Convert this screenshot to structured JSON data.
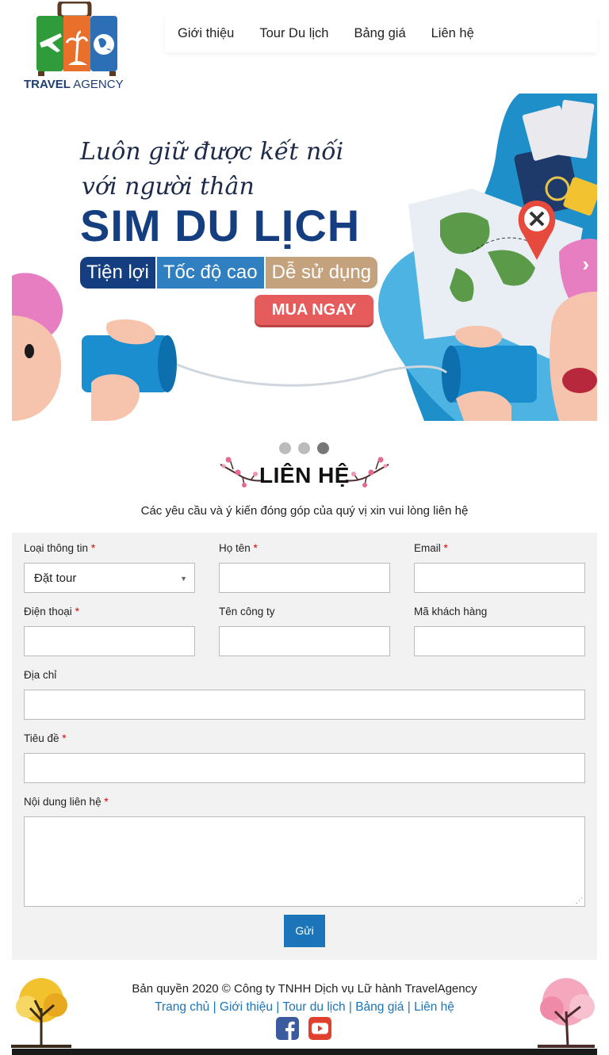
{
  "brand": {
    "logo_text_bold": "TRAVEL",
    "logo_text_light": " AGENCY"
  },
  "nav": {
    "items": [
      "Giới thiệu",
      "Tour Du lịch",
      "Bảng giá",
      "Liên hệ"
    ]
  },
  "banner": {
    "line1": "Luôn giữ được kết nối",
    "line2": "với người thân",
    "headline": "SIM DU LỊCH",
    "pills": [
      "Tiện lợi",
      "Tốc độ cao",
      "Dễ sử dụng"
    ],
    "button": "MUA NGAY",
    "next": "›"
  },
  "carousel": {
    "slide_count": 3,
    "active_index": 2
  },
  "contact": {
    "title": "LIÊN HỆ",
    "subtitle": "Các yêu cầu và ý kiến đóng góp của quý vị xin vui lòng liên hệ"
  },
  "form": {
    "req_mark": "*",
    "info_type": {
      "label": "Loại thông tin",
      "value": "Đặt tour"
    },
    "full_name": {
      "label": "Họ tên",
      "value": ""
    },
    "email": {
      "label": "Email",
      "value": ""
    },
    "phone": {
      "label": "Điện thoại",
      "value": ""
    },
    "company": {
      "label": "Tên công ty",
      "value": ""
    },
    "customer_code": {
      "label": "Mã khách hàng",
      "value": ""
    },
    "address": {
      "label": "Địa chỉ",
      "value": ""
    },
    "subject": {
      "label": "Tiêu đề",
      "value": ""
    },
    "message": {
      "label": "Nội dung liên hệ",
      "value": ""
    },
    "submit": "Gửi"
  },
  "footer": {
    "copyright": "Bản quyền 2020 © Công ty TNHH Dịch vụ Lữ hành TravelAgency",
    "links": [
      "Trang chủ",
      "Giới thiệu",
      "Tour du lịch",
      "Bảng giá",
      "Liên hệ"
    ],
    "separator": " | "
  },
  "colors": {
    "brand_blue": "#1c74b9",
    "panel": "#f2f2f2",
    "required": "#dd0000"
  },
  "icons": [
    "airplane-icon",
    "palm-tree-icon",
    "globe-icon",
    "facebook-icon",
    "youtube-icon",
    "chevron-right-icon",
    "blossom-branch-icon"
  ]
}
